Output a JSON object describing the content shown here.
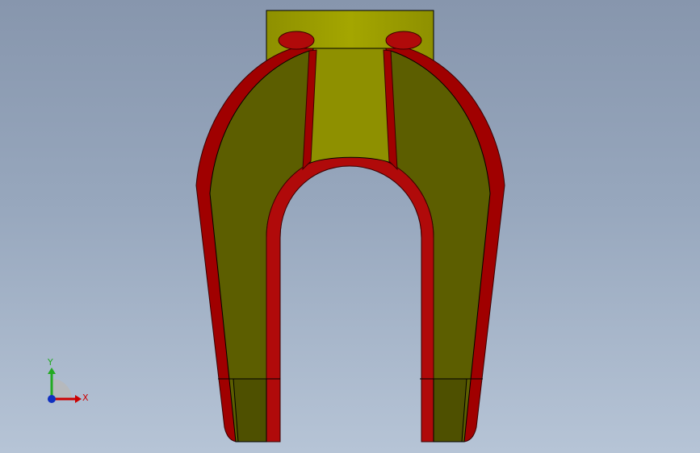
{
  "viewport": {
    "background_top": "#8796ad",
    "background_bottom": "#b6c4d6"
  },
  "model": {
    "face_color_light": "#9a9c00",
    "face_color_dark": "#5a5c00",
    "edge_color": "#a00000",
    "edge_shadow": "#6a0000",
    "outline_color": "#000000"
  },
  "triad": {
    "x_label": "X",
    "y_label": "Y",
    "x_color": "#cc0000",
    "y_color": "#22aa22",
    "z_color": "#1030c0"
  }
}
